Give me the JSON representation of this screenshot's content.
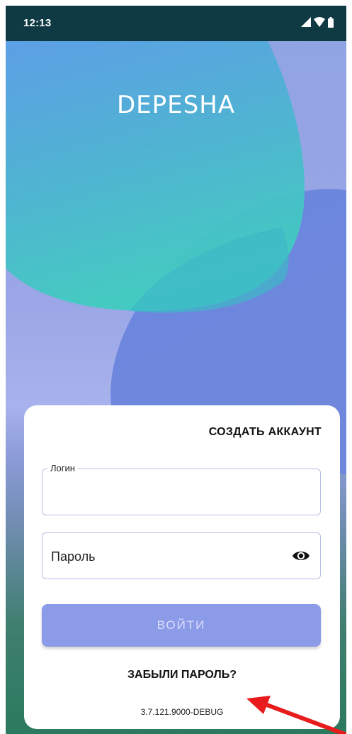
{
  "status_bar": {
    "time": "12:13"
  },
  "app": {
    "title": "DEPESHA"
  },
  "login_card": {
    "create_account": "СОЗДАТЬ АККАУНТ",
    "login_label": "Логин",
    "login_value": "",
    "password_placeholder": "Пароль",
    "login_button": "ВОЙТИ",
    "forgot_password": "ЗАБЫЛИ ПАРОЛЬ?",
    "version": "3.7.121.9000-DEBUG"
  },
  "colors": {
    "status_bar": "#0f3a44",
    "primary_button": "#8c9be8",
    "field_border": "#b7bde6",
    "annotation_arrow": "#e81c1c"
  },
  "icons": [
    "signal-icon",
    "wifi-icon",
    "battery-icon",
    "eye-icon",
    "red-arrow"
  ]
}
